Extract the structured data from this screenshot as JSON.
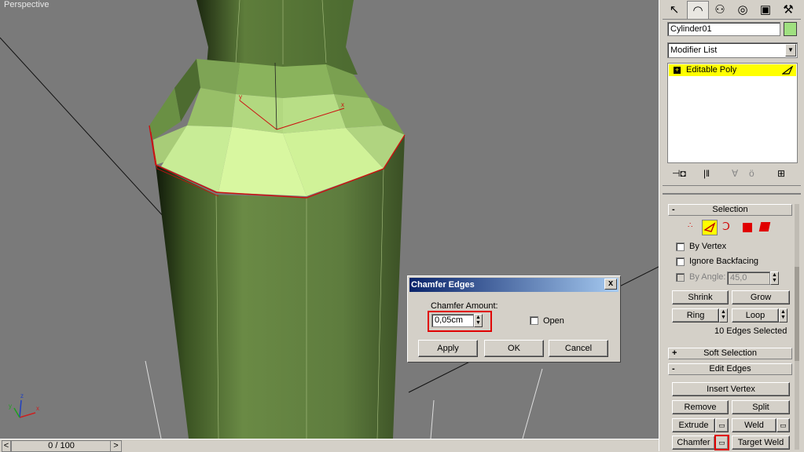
{
  "viewport": {
    "label": "Perspective"
  },
  "timebar": {
    "frame": "0 / 100",
    "prev": "<",
    "next": ">"
  },
  "panel": {
    "tabs": [
      {
        "icon": "create-icon",
        "glyph": "↖"
      },
      {
        "icon": "modify-icon",
        "glyph": "◠"
      },
      {
        "icon": "hierarchy-icon",
        "glyph": "⚇"
      },
      {
        "icon": "motion-icon",
        "glyph": "◎"
      },
      {
        "icon": "display-icon",
        "glyph": "▣"
      },
      {
        "icon": "utilities-icon",
        "glyph": "⚒"
      }
    ],
    "object_name": "Cylinder01",
    "object_color": "#a0e080",
    "modifier_list": "Modifier List",
    "stack_item": "Editable Poly",
    "selection": {
      "title": "Selection",
      "by_vertex": "By Vertex",
      "ignore_backfacing": "Ignore Backfacing",
      "by_angle": "By Angle:",
      "angle_value": "45,0",
      "shrink": "Shrink",
      "grow": "Grow",
      "ring": "Ring",
      "loop": "Loop",
      "status": "10 Edges Selected"
    },
    "soft_selection": {
      "title": "Soft Selection",
      "sign": "+"
    },
    "edit_edges": {
      "title": "Edit Edges",
      "sign": "-",
      "insert_vertex": "Insert Vertex",
      "remove": "Remove",
      "split": "Split",
      "extrude": "Extrude",
      "weld": "Weld",
      "chamfer": "Chamfer",
      "target_weld": "Target Weld"
    }
  },
  "dialog": {
    "title": "Chamfer Edges",
    "close": "x",
    "amount_label": "Chamfer Amount:",
    "amount_value": "0,05cm",
    "open_label": "Open",
    "apply": "Apply",
    "ok": "OK",
    "cancel": "Cancel"
  },
  "colors": {
    "highlight": "#e00000",
    "stack_highlight": "#ffff00",
    "selected_face": "#d8f7a0"
  }
}
